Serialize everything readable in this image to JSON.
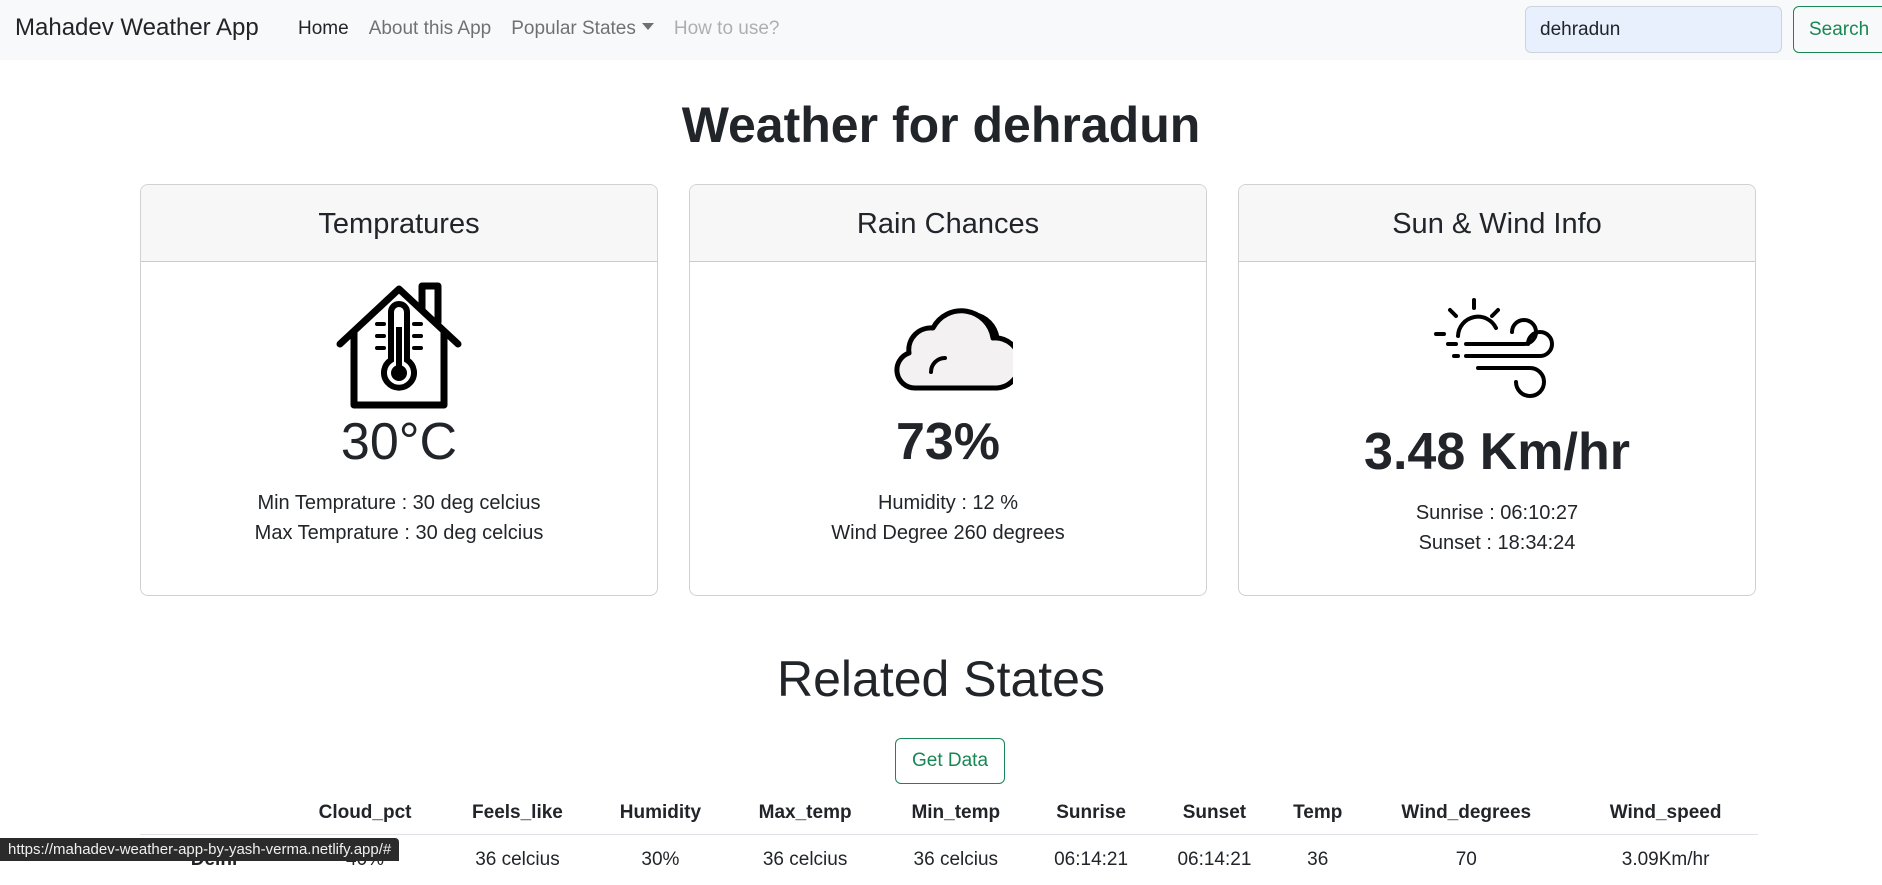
{
  "navbar": {
    "brand": "Mahadev Weather App",
    "links": {
      "home": "Home",
      "about": "About this App",
      "popular": "Popular States",
      "howto": "How to use?"
    },
    "search_value": "dehradun",
    "search_button": "Search"
  },
  "title": "Weather for dehradun",
  "cards": {
    "temperatures": {
      "header": "Tempratures",
      "icon": "house-thermometer-icon",
      "value": "30°C",
      "line1": "Min Temprature : 30 deg celcius",
      "line2": "Max Temprature : 30 deg celcius"
    },
    "rain": {
      "header": "Rain Chances",
      "icon": "cloud-icon",
      "value": "73%",
      "line1": "Humidity : 12 %",
      "line2": "Wind Degree 260 degrees"
    },
    "sunwind": {
      "header": "Sun & Wind Info",
      "icon": "sun-wind-icon",
      "value": "3.48 Km/hr",
      "line1": "Sunrise : 06:10:27",
      "line2": "Sunset : 18:34:24"
    }
  },
  "related": {
    "title": "Related States",
    "button": "Get Data",
    "columns": [
      "Cloud_pct",
      "Feels_like",
      "Humidity",
      "Max_temp",
      "Min_temp",
      "Sunrise",
      "Sunset",
      "Temp",
      "Wind_degrees",
      "Wind_speed"
    ],
    "rows": [
      {
        "state": "Delhi",
        "cells": [
          "40%",
          "36 celcius",
          "30%",
          "36 celcius",
          "36 celcius",
          "06:14:21",
          "06:14:21",
          "36",
          "70",
          "3.09Km/hr"
        ]
      }
    ]
  },
  "status_bar": {
    "url": "https://mahadev-weather-app-by-yash-verma.netlify.app/#"
  }
}
